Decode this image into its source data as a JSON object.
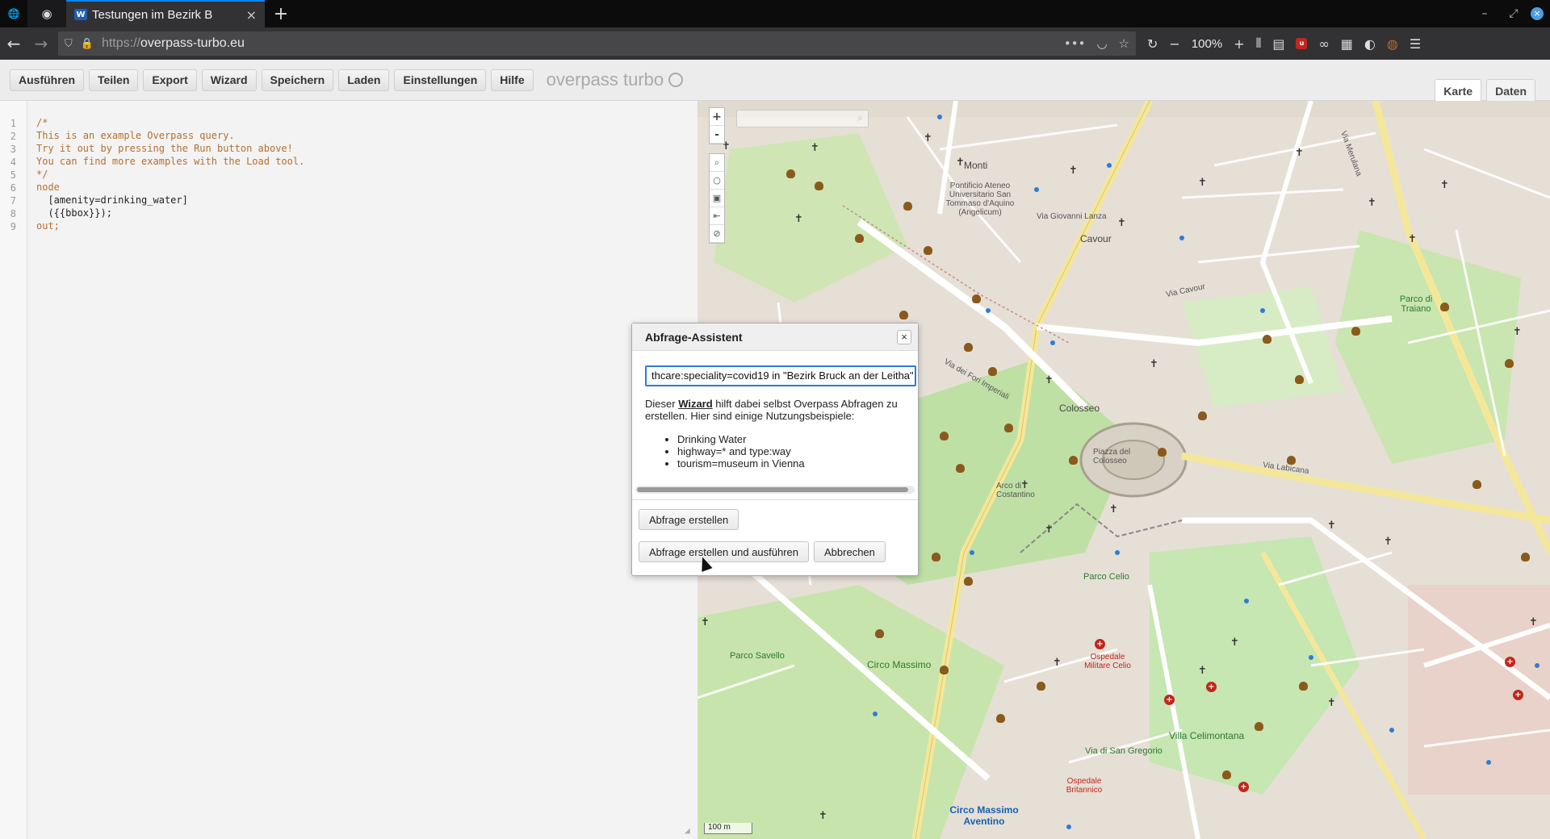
{
  "browser": {
    "tab_title": "Testungen im Bezirk B",
    "url_prefix": "https://",
    "url_host": "overpass-turbo.eu",
    "zoom": "100%"
  },
  "toolbar": {
    "buttons": [
      "Ausführen",
      "Teilen",
      "Export",
      "Wizard",
      "Speichern",
      "Laden",
      "Einstellungen",
      "Hilfe"
    ],
    "brand": "overpass turbo"
  },
  "view_tabs": {
    "map": "Karte",
    "data": "Daten"
  },
  "editor": {
    "lines": [
      {
        "n": "1",
        "text": "/*"
      },
      {
        "n": "2",
        "text": "This is an example Overpass query."
      },
      {
        "n": "3",
        "text": "Try it out by pressing the Run button above!"
      },
      {
        "n": "4",
        "text": "You can find more examples with the Load tool."
      },
      {
        "n": "5",
        "text": "*/"
      },
      {
        "n": "6",
        "text": "node"
      },
      {
        "n": "7",
        "text": "  [amenity=drinking_water]"
      },
      {
        "n": "8",
        "text": "  ({{bbox}});"
      },
      {
        "n": "9",
        "text": "out;"
      }
    ]
  },
  "map": {
    "labels": [
      "Monti",
      "Pontificio Ateneo Universitario San Tommaso d'Aquino (Angelicum)",
      "Cavour",
      "Via Cavour",
      "Via Giovanni Lanza",
      "Parco di Traiano",
      "Colosseo",
      "Piazza del Colosseo",
      "Arco di Costantino",
      "Circo Massimo",
      "Parco Celio",
      "Villa Celimontana",
      "Ospedale Militare Celio",
      "Ospedale Britannico",
      "Via di San Gregorio",
      "Via Labicana",
      "Via Merulana",
      "Via dei Fori Imperiali",
      "Parco Savello",
      "Circo Massimo Aventino"
    ],
    "scale": "100 m",
    "zoom_in": "+",
    "zoom_out": "-"
  },
  "dialog": {
    "title": "Abfrage-Assistent",
    "close": "×",
    "input_value": "thcare:speciality=covid19 in \"Bezirk Bruck an der Leitha\"",
    "intro_before": "Dieser ",
    "intro_link": "Wizard",
    "intro_after": " hilft dabei selbst Overpass Abfragen zu erstellen. Hier sind einige Nutzungsbeispiele:",
    "examples": [
      "Drinking Water",
      "highway=* and type:way",
      "tourism=museum in Vienna"
    ],
    "btn_build": "Abfrage erstellen",
    "btn_build_run": "Abfrage erstellen und ausführen",
    "btn_cancel": "Abbrechen"
  }
}
